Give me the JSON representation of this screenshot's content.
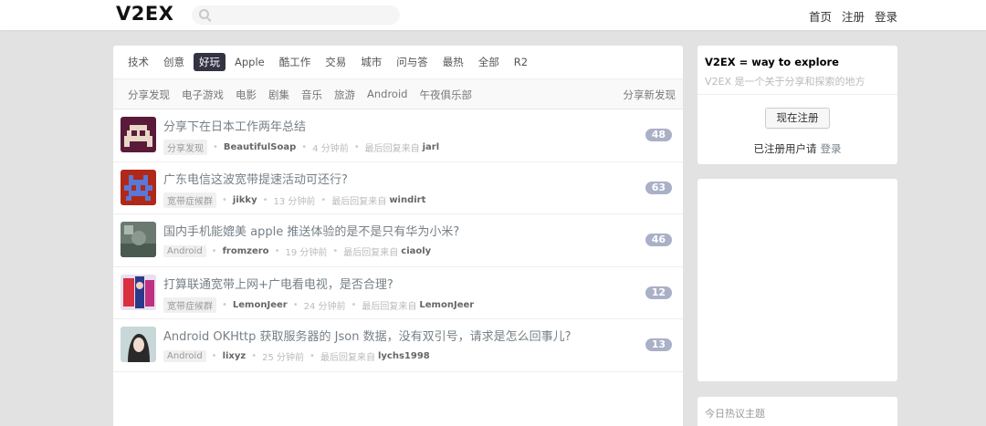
{
  "header": {
    "logo": "V2EX",
    "search_placeholder": "",
    "nav": [
      "首页",
      "注册",
      "登录"
    ]
  },
  "tabs": [
    "技术",
    "创意",
    "好玩",
    "Apple",
    "酷工作",
    "交易",
    "城市",
    "问与答",
    "最热",
    "全部",
    "R2"
  ],
  "active_tab_index": 2,
  "subtabs": [
    "分享发现",
    "电子游戏",
    "电影",
    "剧集",
    "音乐",
    "旅游",
    "Android",
    "午夜俱乐部"
  ],
  "subtabs_right": "分享新发现",
  "topics": [
    {
      "title": "分享下在日本工作两年总结",
      "node": "分享发现",
      "author": "BeautifulSoap",
      "time": "4 分钟前",
      "last_reply_label": "最后回复来自",
      "last_reply": "jarl",
      "replies": "48",
      "avatar_color": "#5a1a3a"
    },
    {
      "title": "广东电信这波宽带提速活动可还行?",
      "node": "宽带症候群",
      "author": "jikky",
      "time": "13 分钟前",
      "last_reply_label": "最后回复来自",
      "last_reply": "windirt",
      "replies": "63",
      "avatar_color": "#b02818"
    },
    {
      "title": "国内手机能媲美 apple 推送体验的是不是只有华为小米?",
      "node": "Android",
      "author": "fromzero",
      "time": "19 分钟前",
      "last_reply_label": "最后回复来自",
      "last_reply": "ciaoly",
      "replies": "46",
      "avatar_color": "#6a7a70"
    },
    {
      "title": "打算联通宽带上网+广电看电视，是否合理?",
      "node": "宽带症候群",
      "author": "LemonJeer",
      "time": "24 分钟前",
      "last_reply_label": "最后回复来自",
      "last_reply": "LemonJeer",
      "replies": "12",
      "avatar_color": "#2a3a8a"
    },
    {
      "title": "Android OKHttp 获取服务器的 Json 数据，没有双引号，请求是怎么回事儿?",
      "node": "Android",
      "author": "lixyz",
      "time": "25 分钟前",
      "last_reply_label": "最后回复来自",
      "last_reply": "lychs1998",
      "replies": "13",
      "avatar_color": "#8aa8a8"
    }
  ],
  "sidebar": {
    "title": "V2EX = way to explore",
    "subtitle": "V2EX 是一个关于分享和探索的地方",
    "register_button": "现在注册",
    "registered_text": "已注册用户请",
    "login_link": "登录",
    "hot_title": "今日热议主题"
  }
}
